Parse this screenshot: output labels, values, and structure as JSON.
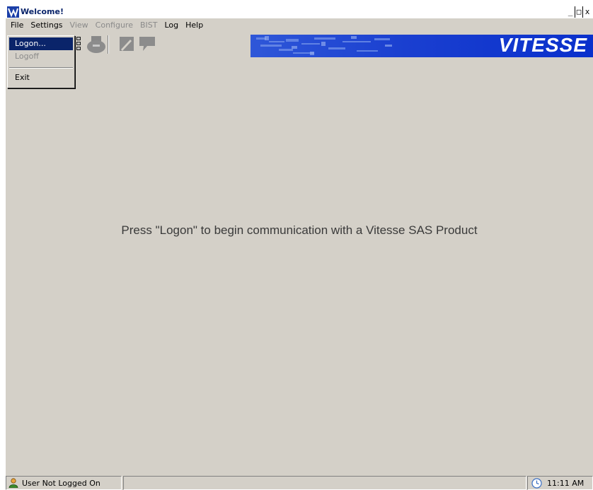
{
  "window": {
    "title": "Welcome!",
    "buttons": {
      "minimize": "_",
      "maximize": "□",
      "close": "x"
    }
  },
  "menubar": {
    "items": [
      {
        "label": "File",
        "enabled": true
      },
      {
        "label": "Settings",
        "enabled": true
      },
      {
        "label": "View",
        "enabled": false
      },
      {
        "label": "Configure",
        "enabled": false
      },
      {
        "label": "BIST",
        "enabled": false
      },
      {
        "label": "Log",
        "enabled": true
      },
      {
        "label": "Help",
        "enabled": true
      }
    ]
  },
  "file_menu": {
    "logon": "Logon...",
    "logoff": "Logoff",
    "exit": "Exit"
  },
  "toolbar": {
    "icons": [
      "list-icon",
      "printer-icon",
      "note-icon",
      "comment-icon"
    ]
  },
  "brand": {
    "name": "VITESSE",
    "color": "#0a33cf"
  },
  "main": {
    "message": "Press \"Logon\" to begin communication with a Vitesse SAS Product"
  },
  "statusbar": {
    "user_status": "User Not Logged On",
    "time": "11:11 AM"
  },
  "colors": {
    "window_bg": "#d4d0c8",
    "highlight": "#0a246a",
    "disabled_text": "#8a8a8a"
  }
}
